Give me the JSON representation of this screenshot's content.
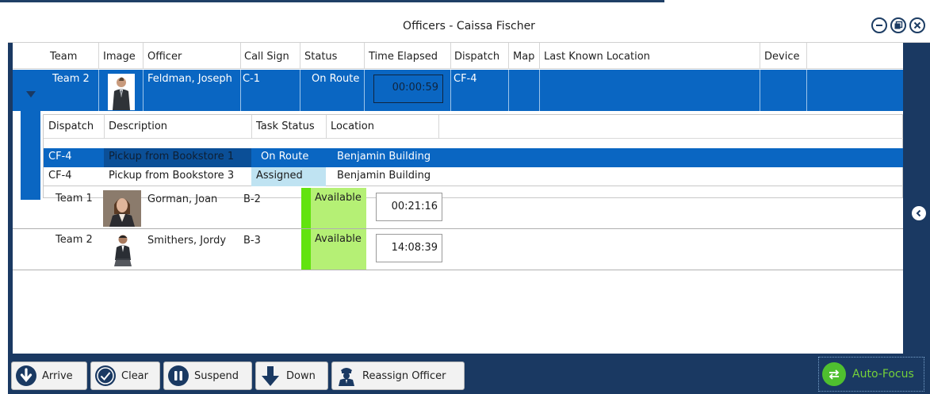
{
  "window": {
    "title": "Officers - Caissa Fischer"
  },
  "grid": {
    "columns": [
      "Team",
      "Image",
      "Officer",
      "Call Sign",
      "Status",
      "Time Elapsed",
      "Dispatch",
      "Map",
      "Last Known Location",
      "Device"
    ],
    "rows": [
      {
        "team": "Team 2",
        "officer": "Feldman, Joseph",
        "call_sign": "C-1",
        "status": "On Route",
        "elapsed": "00:00:59",
        "dispatch": "CF-4"
      },
      {
        "team": "Team 1",
        "officer": "Gorman, Joan",
        "call_sign": "B-2",
        "status": "Available",
        "elapsed": "00:21:16"
      },
      {
        "team": "Team 2",
        "officer": "Smithers, Jordy",
        "call_sign": "B-3",
        "status": "Available",
        "elapsed": "14:08:39"
      }
    ]
  },
  "dispatch_detail": {
    "columns": [
      "Dispatch",
      "Description",
      "Task Status",
      "Location"
    ],
    "rows": [
      {
        "dispatch": "CF-4",
        "description": "Pickup from Bookstore 1",
        "task_status": "On Route",
        "location": "Benjamin Building"
      },
      {
        "dispatch": "CF-4",
        "description": "Pickup from Bookstore 3",
        "task_status": "Assigned",
        "location": "Benjamin Building"
      }
    ]
  },
  "toolbar": {
    "arrive": "Arrive",
    "clear": "Clear",
    "suspend": "Suspend",
    "down": "Down",
    "reassign": "Reassign Officer",
    "autofocus": "Auto-Focus"
  },
  "colors": {
    "frame": "#1a3962",
    "selection": "#0a66c2",
    "available": "#b5f075",
    "available_bar": "#62e30f",
    "autofocus_text": "#75d13a"
  },
  "icons": [
    "minimize-icon",
    "restore-icon",
    "close-icon",
    "expand-arrow-icon",
    "collapse-panel-icon",
    "arrive-icon",
    "clear-icon",
    "suspend-icon",
    "down-icon",
    "reassign-officer-icon",
    "auto-focus-icon"
  ]
}
